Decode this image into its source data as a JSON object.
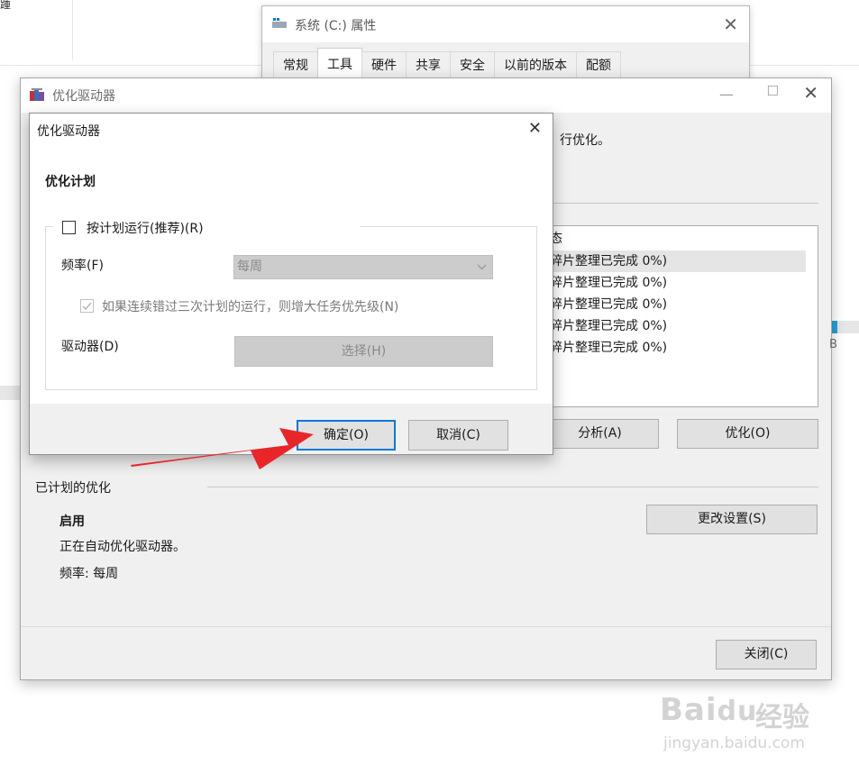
{
  "background": {
    "leftfragment": "踵"
  },
  "props_window": {
    "title": "系统 (C:) 属性",
    "close_glyph": "✕",
    "tabs": [
      "常规",
      "工具",
      "硬件",
      "共享",
      "安全",
      "以前的版本",
      "配额"
    ],
    "active_tab_index": 1
  },
  "main_window": {
    "title": "优化驱动器",
    "partial_text": "行优化。",
    "status_list": {
      "header": "态",
      "rows": [
        "碎片整理已完成 0%)",
        "碎片整理已完成 0%)",
        "碎片整理已完成 0%)",
        "碎片整理已完成 0%)",
        "碎片整理已完成 0%)"
      ],
      "selected_row": 0
    },
    "side_fragment": "B",
    "analyze_button": "分析(A)",
    "optimize_button": "优化(O)",
    "scheduled_section": {
      "heading": "已计划的优化",
      "status": "启用",
      "description": "正在自动优化驱动器。",
      "frequency": "频率: 每周"
    },
    "change_settings_button": "更改设置(S)",
    "close_button": "关闭(C)"
  },
  "dialog": {
    "title": "优化驱动器",
    "close_glyph": "✕",
    "section_heading": "优化计划",
    "run_on_schedule_label": "按计划运行(推荐)(R)",
    "run_on_schedule_checked": false,
    "frequency_label": "频率(F)",
    "frequency_value": "每周",
    "increase_priority_label": "如果连续错过三次计划的运行，则增大任务优先级(N)",
    "increase_priority_checked": true,
    "drives_label": "驱动器(D)",
    "select_button": "选择(H)",
    "ok_button": "确定(O)",
    "cancel_button": "取消(C)"
  },
  "watermark": {
    "brand": "Bai",
    "brand2": "du",
    "brand_cn": "经验",
    "url": "jingyan.baidu.com"
  },
  "colors": {
    "accent": "#0078d7",
    "arrow": "#e8262a"
  }
}
